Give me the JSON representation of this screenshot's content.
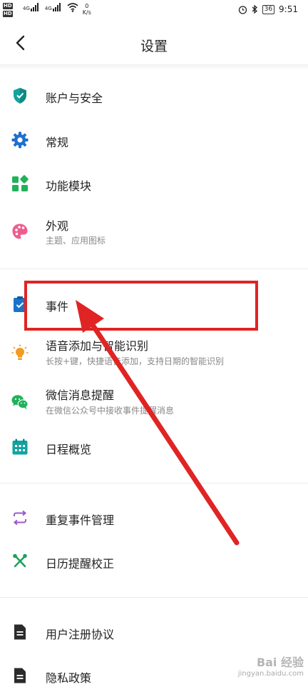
{
  "status_bar": {
    "hd_top": "HD",
    "hd_bottom": "HD",
    "net1": "4G",
    "net2": "4G",
    "speed_value": "0",
    "speed_unit": "K/s",
    "battery": "36",
    "time": "9:51"
  },
  "header": {
    "title": "设置"
  },
  "items": [
    {
      "label": "账户与安全",
      "icon": "shield-icon"
    },
    {
      "label": "常规",
      "icon": "gear-icon"
    },
    {
      "label": "功能模块",
      "icon": "modules-icon"
    },
    {
      "label": "外观",
      "subtitle": "主题、应用图标",
      "icon": "palette-icon"
    },
    {
      "label": "事件",
      "icon": "clipboard-check-icon"
    },
    {
      "label": "语音添加与智能识别",
      "subtitle": "长按+键，快捷语音添加，支持日期的智能识别",
      "icon": "lightbulb-icon"
    },
    {
      "label": "微信消息提醒",
      "subtitle": "在微信公众号中接收事件提醒消息",
      "icon": "wechat-icon"
    },
    {
      "label": "日程概览",
      "icon": "calendar-icon"
    },
    {
      "label": "重复事件管理",
      "icon": "repeat-icon"
    },
    {
      "label": "日历提醒校正",
      "icon": "wrench-icon"
    },
    {
      "label": "用户注册协议",
      "icon": "document-icon"
    },
    {
      "label": "隐私政策",
      "icon": "document-icon"
    }
  ],
  "watermark": {
    "brand": "Bai 经验",
    "url": "jingyan.baidu.com"
  },
  "colors": {
    "accent_red": "#e02424",
    "teal": "#12a3a0",
    "blue": "#1e6fcf",
    "green": "#1fb25a"
  }
}
